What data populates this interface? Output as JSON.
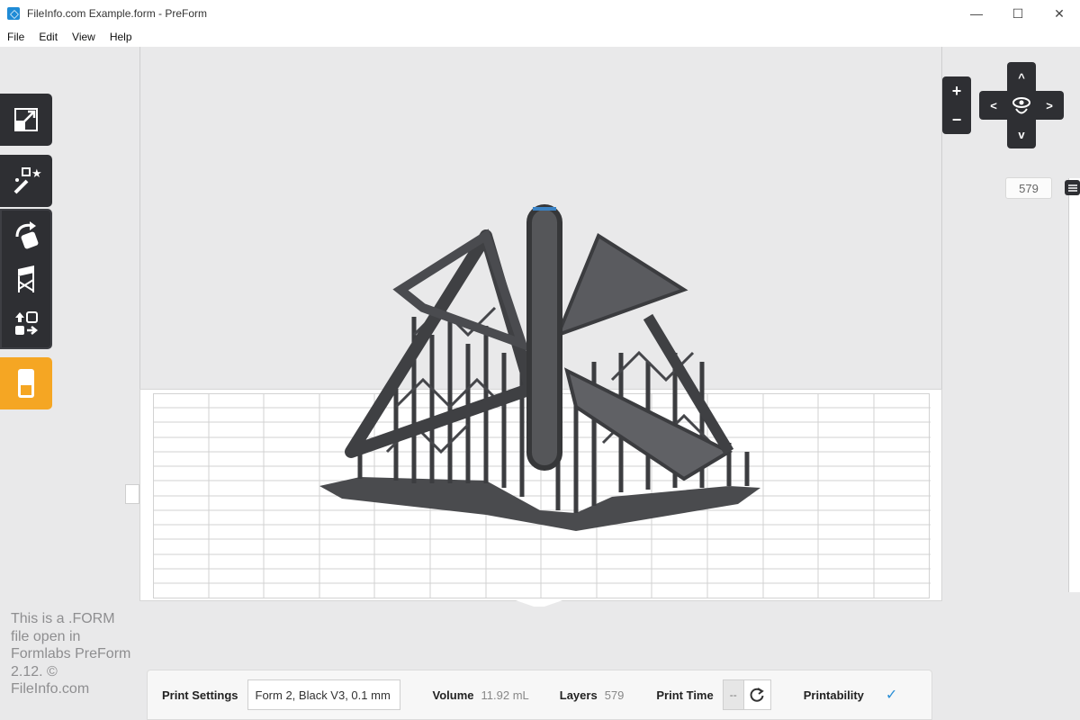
{
  "window": {
    "title": "FileInfo.com Example.form - PreForm",
    "controls": {
      "minimize": "—",
      "maximize": "☐",
      "close": "✕"
    }
  },
  "menu": [
    "File",
    "Edit",
    "View",
    "Help"
  ],
  "toolbar": {
    "icons": [
      "fit-view-icon",
      "magic-wand-icon",
      "rotate-icon",
      "supports-icon",
      "layout-icon",
      "job-icon"
    ],
    "active_color": "#f5a623",
    "dark_color": "#2e2f33"
  },
  "navigation": {
    "zoom_in": "+",
    "zoom_out": "−",
    "up": "^",
    "down": "v",
    "left": "<",
    "right": ">"
  },
  "layer_slider": {
    "value": "579"
  },
  "watermark": "This is a .FORM file open in Formlabs PreForm 2.12. © FileInfo.com",
  "bottom_bar": {
    "print_settings_label": "Print Settings",
    "print_settings_value": "Form 2, Black V3, 0.1 mm",
    "volume_label": "Volume",
    "volume_value": "11.92 mL",
    "layers_label": "Layers",
    "layers_value": "579",
    "print_time_label": "Print Time",
    "print_time_value": "--",
    "printability_label": "Printability",
    "printability_status": "✓",
    "status_color": "#2b8fd6"
  }
}
